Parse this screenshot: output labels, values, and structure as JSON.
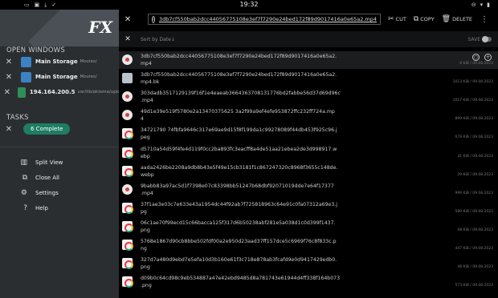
{
  "status_bar": {
    "time": "19:32",
    "left_icons": [
      "notification-icon",
      "photo-icon",
      "download-icon",
      "check-icon"
    ],
    "right_icons": [
      "dnd-icon",
      "wifi-icon",
      "battery-icon"
    ]
  },
  "drawer": {
    "logo": "FX",
    "open_windows_title": "OPEN WINDOWS",
    "windows": [
      {
        "name": "Main Storage",
        "path": "Movies/",
        "color": "#3b82c4"
      },
      {
        "name": "Main Storage",
        "path": "Movies/",
        "color": "#3b82c4"
      },
      {
        "name": "194.164.200.5",
        "path": "var/lib/akioma/uploads/",
        "color": "#2f8f58"
      }
    ],
    "tasks_title": "TASKS",
    "tasks_badge": "6 Complete",
    "menu": [
      {
        "label": "Split View",
        "icon": "split-view-icon",
        "glyph": "▥"
      },
      {
        "label": "Close All",
        "icon": "close-all-icon",
        "glyph": "⧉"
      },
      {
        "label": "Settings",
        "icon": "gear-icon",
        "glyph": "⚙"
      },
      {
        "label": "Help",
        "icon": "help-icon",
        "glyph": "?"
      }
    ]
  },
  "toolbar": {
    "filename": "3db7cf550bab2dcc44056775108e3ef7f7290e24bed172f89d9017416a0e65a2.mp4",
    "cut": "CUT",
    "copy": "COPY",
    "delete": "DELETE"
  },
  "sortbar": {
    "placeholder": "Sort by Date↓",
    "save": "SAVE"
  },
  "files": [
    {
      "line1": "3db7cf550bab2dcc44056775108e3ef7f7290e24bed172f89d9017416a0e65a2.",
      "line2": "mp4",
      "meta": "6 KiB / 09.08.2023",
      "type": "video",
      "selected": true
    },
    {
      "line1": "3db7cf550bab2dcc44056775108e3ef7f7290e24bed172f89d9017416a0e65a2.",
      "line2": "mp4.bk",
      "meta": "1013 KiB / 09.08.2023",
      "type": "file",
      "selected": false
    },
    {
      "line1": "303dadb3517129139f16f1e4eaeab3664363708131776bd2fabbe56d37d69d96c",
      "line2": ".mp4",
      "meta": "1017 KiB / 09.08.2023",
      "type": "video",
      "selected": false
    },
    {
      "line1": "49d1e39e519f5780e2a13470375625 3a2f99a9ef4efe953872ffc232ff724a.mp",
      "line2": "4",
      "meta": "899 KiB / 09.08.2023",
      "type": "video",
      "selected": false
    },
    {
      "line1": "34721790 74fbfa9646c317e69ae9d15f8f199da1c99278089f44db453f925c96.j",
      "line2": "peg",
      "meta": "679 KiB / 09.08.2023",
      "type": "img",
      "selected": false
    },
    {
      "line1": "d5710a54d59f4fe4d119f0cc2ba893fc3eacff8a4de51aa21ebea2de3d998917.w",
      "line2": "ebp",
      "meta": "31 KiB / 09.08.2023",
      "type": "img",
      "selected": false
    },
    {
      "line1": "aada2426be2208a9db8b43e5f49e15cb3181f1c867247320c8968f3655c148de.",
      "line2": "webp",
      "meta": "29 KiB / 09.08.2023",
      "type": "img",
      "selected": false
    },
    {
      "line1": "9babb83a97ac5d1f7398e07c83398bb51247b68dbf92071019dde7e64f17377",
      "line2": ".mp4",
      "meta": "999 KiB / 09.08.2023",
      "type": "video",
      "selected": false
    },
    {
      "line1": "37f1ae3e03c7e633e43a1954dc44f92ab7f725818963c64e91c0fa07312a69e3.j",
      "line2": "pg",
      "meta": "589 KiB / 09.08.2023",
      "type": "img",
      "selected": false
    },
    {
      "line1": "06c1ae70f99ecd15c66bacca125f317d6b50238abf281e5a038d1c0d399f1437.",
      "line2": "png",
      "meta": "48 KiB / 09.08.2023",
      "type": "img",
      "selected": false
    },
    {
      "line1": "5768e1867d90cb8bbe502fdf00a2e950d23aad37ff157dce5c6969f76c8f833c.p",
      "line2": "ng",
      "meta": "447 KiB / 09.08.2023",
      "type": "img",
      "selected": false
    },
    {
      "line1": "327d7a480d9ebd7e5efa10d3b160e61f3c718e878ab3fcafd9e0d9417429edb0.",
      "line2": "png",
      "meta": "48 KiB / 09.08.2023",
      "type": "img",
      "selected": false
    },
    {
      "line1": "d09b0c64cd98c9eb534887a47e42ebd9485d8a781743e61944d4ff338f164b073",
      "line2": ".png",
      "meta": "573 KiB / 09.08.2023",
      "type": "img",
      "selected": false
    }
  ]
}
